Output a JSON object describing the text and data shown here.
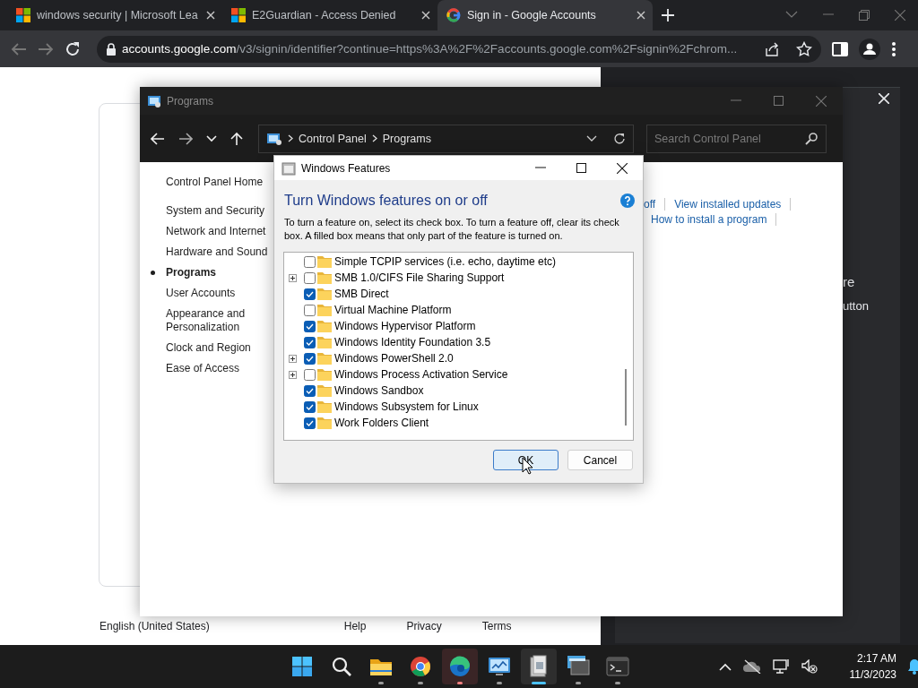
{
  "browser": {
    "tabs": [
      {
        "title": "windows security | Microsoft Lea",
        "kind": "tiles",
        "selected": false
      },
      {
        "title": "E2Guardian - Access Denied",
        "kind": "tiles",
        "selected": false
      },
      {
        "title": "Sign in - Google Accounts",
        "kind": "glogo",
        "selected": true
      }
    ],
    "address": {
      "host": "accounts.google.com",
      "path": "/v3/signin/identifier?continue=https%3A%2F%2Faccounts.google.com%2Fsignin%2Fchrom..."
    }
  },
  "page": {
    "footer": [
      "English (United States)",
      "Help",
      "Privacy",
      "Terms"
    ],
    "side_panel": {
      "lines": [
        "re",
        "utton"
      ]
    }
  },
  "control_panel": {
    "title": "Programs",
    "breadcrumb": [
      "Control Panel",
      "Programs"
    ],
    "search": {
      "placeholder": "Search Control Panel"
    },
    "home": "Control Panel Home",
    "nav": [
      {
        "label": "System and Security",
        "selected": false
      },
      {
        "label": "Network and Internet",
        "selected": false
      },
      {
        "label": "Hardware and Sound",
        "selected": false
      },
      {
        "label": "Programs",
        "selected": true
      },
      {
        "label": "User Accounts",
        "selected": false
      },
      {
        "label": "Appearance and Personalization",
        "selected": false
      },
      {
        "label": "Clock and Region",
        "selected": false
      },
      {
        "label": "Ease of Access",
        "selected": false
      }
    ],
    "links": [
      [
        "off",
        "View installed updates"
      ],
      [
        "How to install a program"
      ]
    ]
  },
  "dialog": {
    "title": "Windows Features",
    "heading": "Turn Windows features on or off",
    "description": "To turn a feature on, select its check box. To turn a feature off, clear its check box. A filled box means that only part of the feature is turned on.",
    "features": [
      {
        "label": "Simple TCPIP services (i.e. echo, daytime etc)",
        "checked": false,
        "expandable": false
      },
      {
        "label": "SMB 1.0/CIFS File Sharing Support",
        "checked": false,
        "expandable": true
      },
      {
        "label": "SMB Direct",
        "checked": true,
        "expandable": false
      },
      {
        "label": "Virtual Machine Platform",
        "checked": false,
        "expandable": false
      },
      {
        "label": "Windows Hypervisor Platform",
        "checked": true,
        "expandable": false
      },
      {
        "label": "Windows Identity Foundation 3.5",
        "checked": true,
        "expandable": false
      },
      {
        "label": "Windows PowerShell 2.0",
        "checked": true,
        "expandable": true
      },
      {
        "label": "Windows Process Activation Service",
        "checked": false,
        "expandable": true
      },
      {
        "label": "Windows Sandbox",
        "checked": true,
        "expandable": false
      },
      {
        "label": "Windows Subsystem for Linux",
        "checked": true,
        "expandable": false
      },
      {
        "label": "Work Folders Client",
        "checked": true,
        "expandable": false
      }
    ],
    "buttons": [
      {
        "label": "OK",
        "default": true
      },
      {
        "label": "Cancel",
        "default": false
      }
    ]
  },
  "taskbar": {
    "apps": [
      {
        "kind": "start",
        "running": false,
        "attention": false,
        "selected": false
      },
      {
        "kind": "search",
        "running": false,
        "attention": false,
        "selected": false
      },
      {
        "kind": "folder",
        "running": true,
        "attention": false,
        "selected": false
      },
      {
        "kind": "chrome",
        "running": true,
        "attention": false,
        "selected": false
      },
      {
        "kind": "edge",
        "running": true,
        "attention": true,
        "selected": false
      },
      {
        "kind": "panel",
        "running": true,
        "attention": false,
        "selected": false
      },
      {
        "kind": "features",
        "running": true,
        "attention": false,
        "selected": true
      },
      {
        "kind": "remote",
        "running": true,
        "attention": false,
        "selected": false
      },
      {
        "kind": "terminal",
        "running": true,
        "attention": false,
        "selected": false
      }
    ],
    "clock": {
      "time": "2:17 AM",
      "date": "11/3/2023"
    }
  }
}
